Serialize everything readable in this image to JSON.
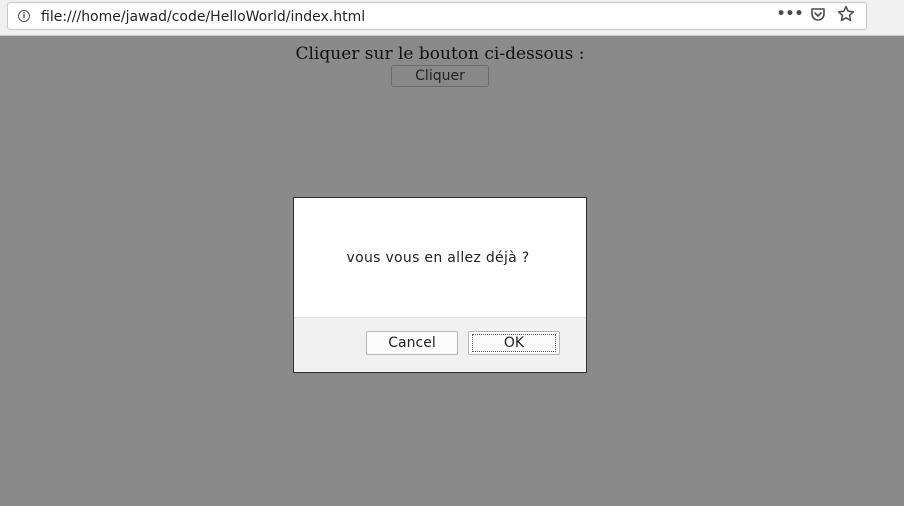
{
  "browser": {
    "url": "file:///home/jawad/code/HelloWorld/index.html",
    "icons": [
      "info-icon",
      "more-icon",
      "pocket-icon",
      "bookmark-star-icon"
    ]
  },
  "page": {
    "instruction": "Cliquer sur le bouton ci-dessous :",
    "button_label": "Cliquer"
  },
  "dialog": {
    "message": "vous vous en allez déjà ?",
    "cancel_label": "Cancel",
    "ok_label": "OK"
  },
  "colors": {
    "overlay": "#8a8a8a",
    "toolbar": "#f0f0f0",
    "dialog_footer": "#f0f0f0"
  }
}
